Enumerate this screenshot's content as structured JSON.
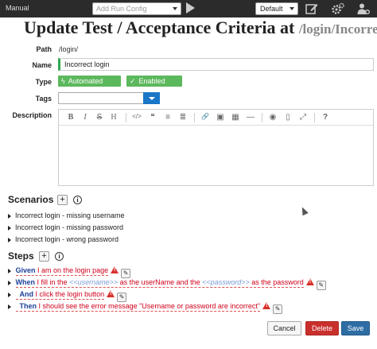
{
  "topbar": {
    "mode": "Manual",
    "run_config_placeholder": "Add Run Config",
    "profile": "Default",
    "icons": [
      "play-icon",
      "edit-icon",
      "gears-icon",
      "users-settings-icon"
    ]
  },
  "title": {
    "main": "Update Test / Acceptance Criteria at ",
    "path": "/login/Incorrect"
  },
  "form": {
    "path_label": "Path",
    "path_value": "/login/",
    "name_label": "Name",
    "name_value": "Incorrect login",
    "type_label": "Type",
    "type_value": "Automated",
    "enabled_value": "Enabled",
    "tags_label": "Tags",
    "description_label": "Description"
  },
  "editor_tools": [
    "B",
    "I",
    "S",
    "H",
    "</>",
    "❝",
    "≡",
    "≣",
    "🔗",
    "▣",
    "▦",
    "—",
    "◉",
    "▯",
    "⤢",
    "?"
  ],
  "scenarios": {
    "heading": "Scenarios",
    "items": [
      "Incorrect login - missing username",
      "Incorrect login - missing password",
      "Incorrect login - wrong password"
    ]
  },
  "steps": {
    "heading": "Steps",
    "items": [
      {
        "kw": "Given",
        "pre": "I am on the login page",
        "p1": "",
        "mid": "",
        "p2": "",
        "post": ""
      },
      {
        "kw": "When",
        "pre": "I fill in the ",
        "p1": "<<username>>",
        "mid": " as the userName and the ",
        "p2": "<<password>>",
        "post": " as the password"
      },
      {
        "kw": "And",
        "pre": "I click the login button",
        "p1": "",
        "mid": "",
        "p2": "",
        "post": ""
      },
      {
        "kw": "Then",
        "pre": "I should see the error message \"Username or password are incorrect\"",
        "p1": "",
        "mid": "",
        "p2": "",
        "post": ""
      }
    ]
  },
  "buttons": {
    "cancel": "Cancel",
    "delete": "Delete",
    "save": "Save"
  },
  "colors": {
    "topbar": "#2b2b2b",
    "success": "#5cb85c",
    "danger": "#c9302c",
    "primary": "#2e6da4",
    "keyword": "#1b3f9a",
    "step_text": "#d0021b"
  }
}
